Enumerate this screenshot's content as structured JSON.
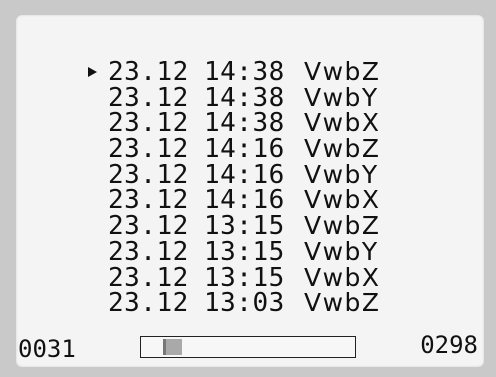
{
  "log": {
    "selected_index": 0,
    "rows": [
      {
        "date": "23.12",
        "time": "14:38",
        "tag": "VwbZ"
      },
      {
        "date": "23.12",
        "time": "14:38",
        "tag": "VwbY"
      },
      {
        "date": "23.12",
        "time": "14:38",
        "tag": "VwbX"
      },
      {
        "date": "23.12",
        "time": "14:16",
        "tag": "VwbZ"
      },
      {
        "date": "23.12",
        "time": "14:16",
        "tag": "VwbY"
      },
      {
        "date": "23.12",
        "time": "14:16",
        "tag": "VwbX"
      },
      {
        "date": "23.12",
        "time": "13:15",
        "tag": "VwbZ"
      },
      {
        "date": "23.12",
        "time": "13:15",
        "tag": "VwbY"
      },
      {
        "date": "23.12",
        "time": "13:15",
        "tag": "VwbX"
      },
      {
        "date": "23.12",
        "time": "13:03",
        "tag": "VwbZ"
      }
    ]
  },
  "footer": {
    "left_count": "0031",
    "right_count": "0298",
    "scroll_position_fraction": 0.1,
    "scroll_thumb_fraction": 0.09
  },
  "icons": {
    "cursor": "triangle-right-icon"
  }
}
